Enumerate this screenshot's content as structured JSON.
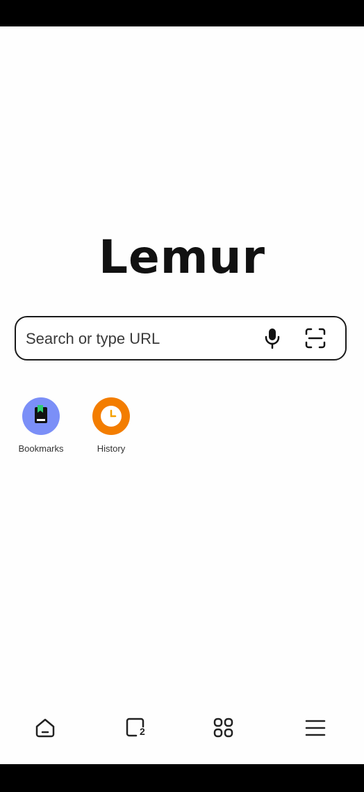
{
  "logo": {
    "text": "Lemur"
  },
  "search": {
    "placeholder": "Search or type URL",
    "value": ""
  },
  "shortcuts": [
    {
      "label": "Bookmarks",
      "icon": "bookmark-icon",
      "color": "#7b8ff7"
    },
    {
      "label": "History",
      "icon": "clock-icon",
      "color": "#f37d00"
    }
  ],
  "bottom_nav": {
    "home_icon": "home-icon",
    "tabs_icon": "tabs-icon",
    "tabs_count": "2",
    "apps_icon": "grid-icon",
    "menu_icon": "menu-icon"
  },
  "colors": {
    "bookmark_bg": "#7b8ff7",
    "history_bg": "#f37d00",
    "accent_green": "#2ecc71",
    "accent_yellow": "#f5a000"
  }
}
